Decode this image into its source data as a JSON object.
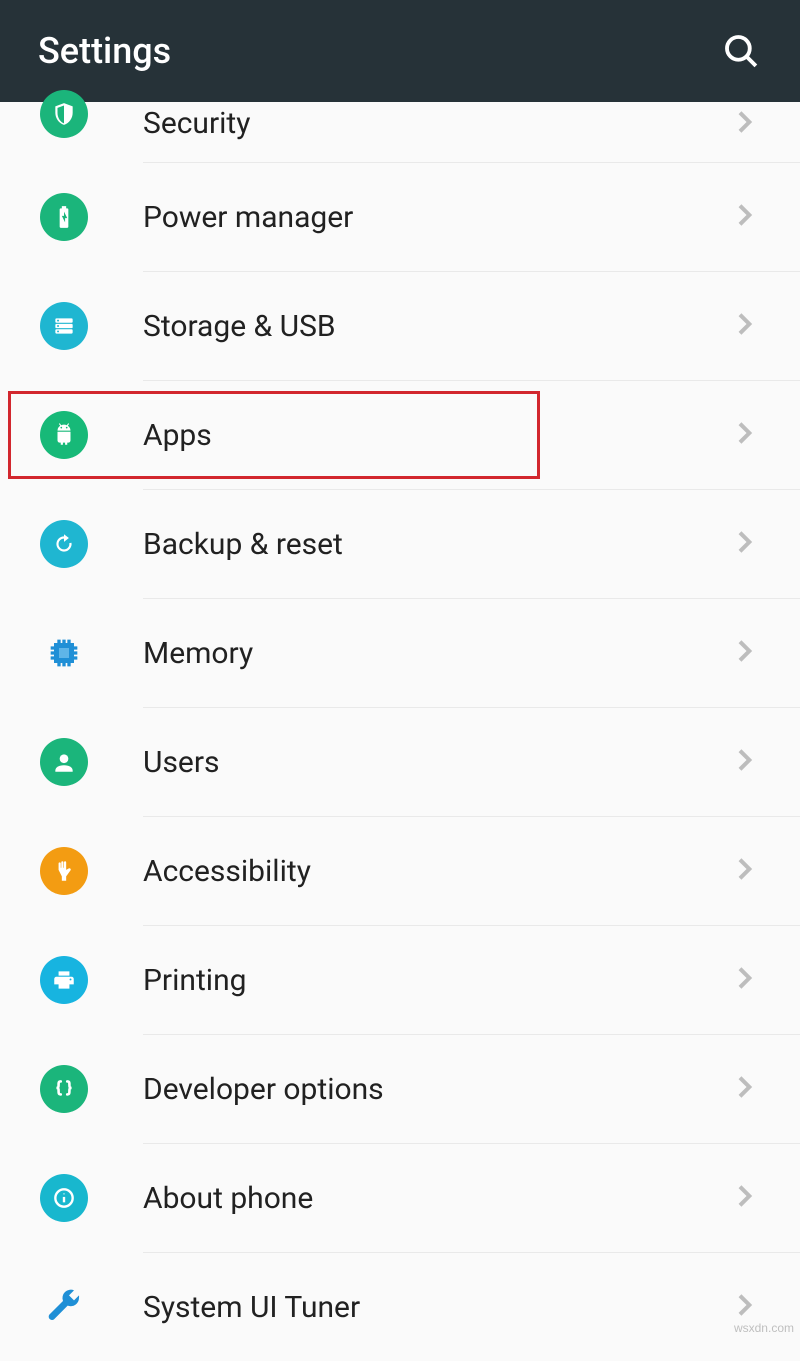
{
  "header": {
    "title": "Settings"
  },
  "items": [
    {
      "label": "Security"
    },
    {
      "label": "Power manager"
    },
    {
      "label": "Storage & USB"
    },
    {
      "label": "Apps"
    },
    {
      "label": "Backup & reset"
    },
    {
      "label": "Memory"
    },
    {
      "label": "Users"
    },
    {
      "label": "Accessibility"
    },
    {
      "label": "Printing"
    },
    {
      "label": "Developer options"
    },
    {
      "label": "About phone"
    },
    {
      "label": "System UI Tuner"
    }
  ],
  "watermark": "wsxdn.com"
}
